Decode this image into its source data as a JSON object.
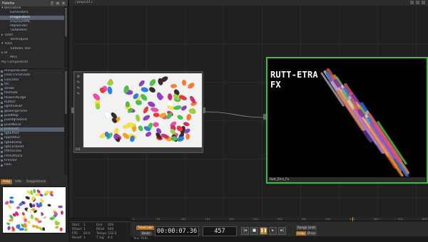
{
  "palette": {
    "title": "Palette",
    "tree": [
      {
        "type": "section",
        "label": "▾ Derivative"
      },
      {
        "type": "item",
        "label": "Generators"
      },
      {
        "type": "item",
        "label": "ImageFilters",
        "selected": true
      },
      {
        "type": "item",
        "label": "DisplayHtML"
      },
      {
        "type": "item",
        "label": "PopSender"
      },
      {
        "type": "item",
        "label": "TDAbleton"
      },
      {
        "type": "section",
        "label": "▸ TDVR"
      },
      {
        "type": "item",
        "label": "Techniques"
      },
      {
        "type": "section",
        "label": "▾ Tools"
      },
      {
        "type": "item",
        "label": "Turbotix Tool"
      },
      {
        "type": "section",
        "label": "▸ UI"
      },
      {
        "type": "item",
        "label": "Misc"
      },
      {
        "type": "section",
        "label": "My Components"
      }
    ],
    "list": [
      "muspeToColor",
      "colorThresholds",
      "concrete",
      "tilt",
      "stroke",
      "flexfade",
      "flexEmitEdge",
      "RuttEtr",
      "lightleakwf",
      "glowingFrame",
      "ipadMap",
      "pixelfgradient",
      "pixelNoise",
      "pixelSort",
      "rgbEffect",
      "rippleBlur",
      "rgbSBokay",
      "rgbClickedd",
      "rfilmscrew",
      "rmRuttEtra",
      "tvVictor",
      "halo"
    ],
    "selected_list_item": "pixelSort",
    "tabs": [
      "Help",
      "Info",
      "Suggestions"
    ],
    "active_tab": "Help"
  },
  "network": {
    "path": "/ project1 /",
    "input_node_label": "in1",
    "output_node_label": "Rutt_Etra_Fx",
    "output_title": "RUTT-ETRA\nFX",
    "output_border_color": "#3fbf3f"
  },
  "info": {
    "rows": [
      [
        "Start",
        "1",
        "End",
        "600"
      ],
      [
        "RStart",
        "1",
        "REnd",
        "600"
      ],
      [
        "FPS",
        "60.0",
        "Tempo",
        "120.0"
      ],
      [
        "Resetf",
        "1",
        "T Sig",
        "4  4"
      ]
    ]
  },
  "timeline": {
    "ticks": [
      "1",
      "51",
      "101",
      "151",
      "201",
      "251",
      "301",
      "351",
      "401",
      "451",
      "501",
      "551",
      "600"
    ],
    "timecode": "00:00:07.36",
    "frame": "457",
    "realtime_label": "Range Limit",
    "loop_label": "Loop",
    "once_label": "Once",
    "beat_label": "TimeCode",
    "beats_label": "Beats",
    "accent_color": "#c07a2c"
  },
  "command": {
    "placeholder": "Your Path..."
  }
}
